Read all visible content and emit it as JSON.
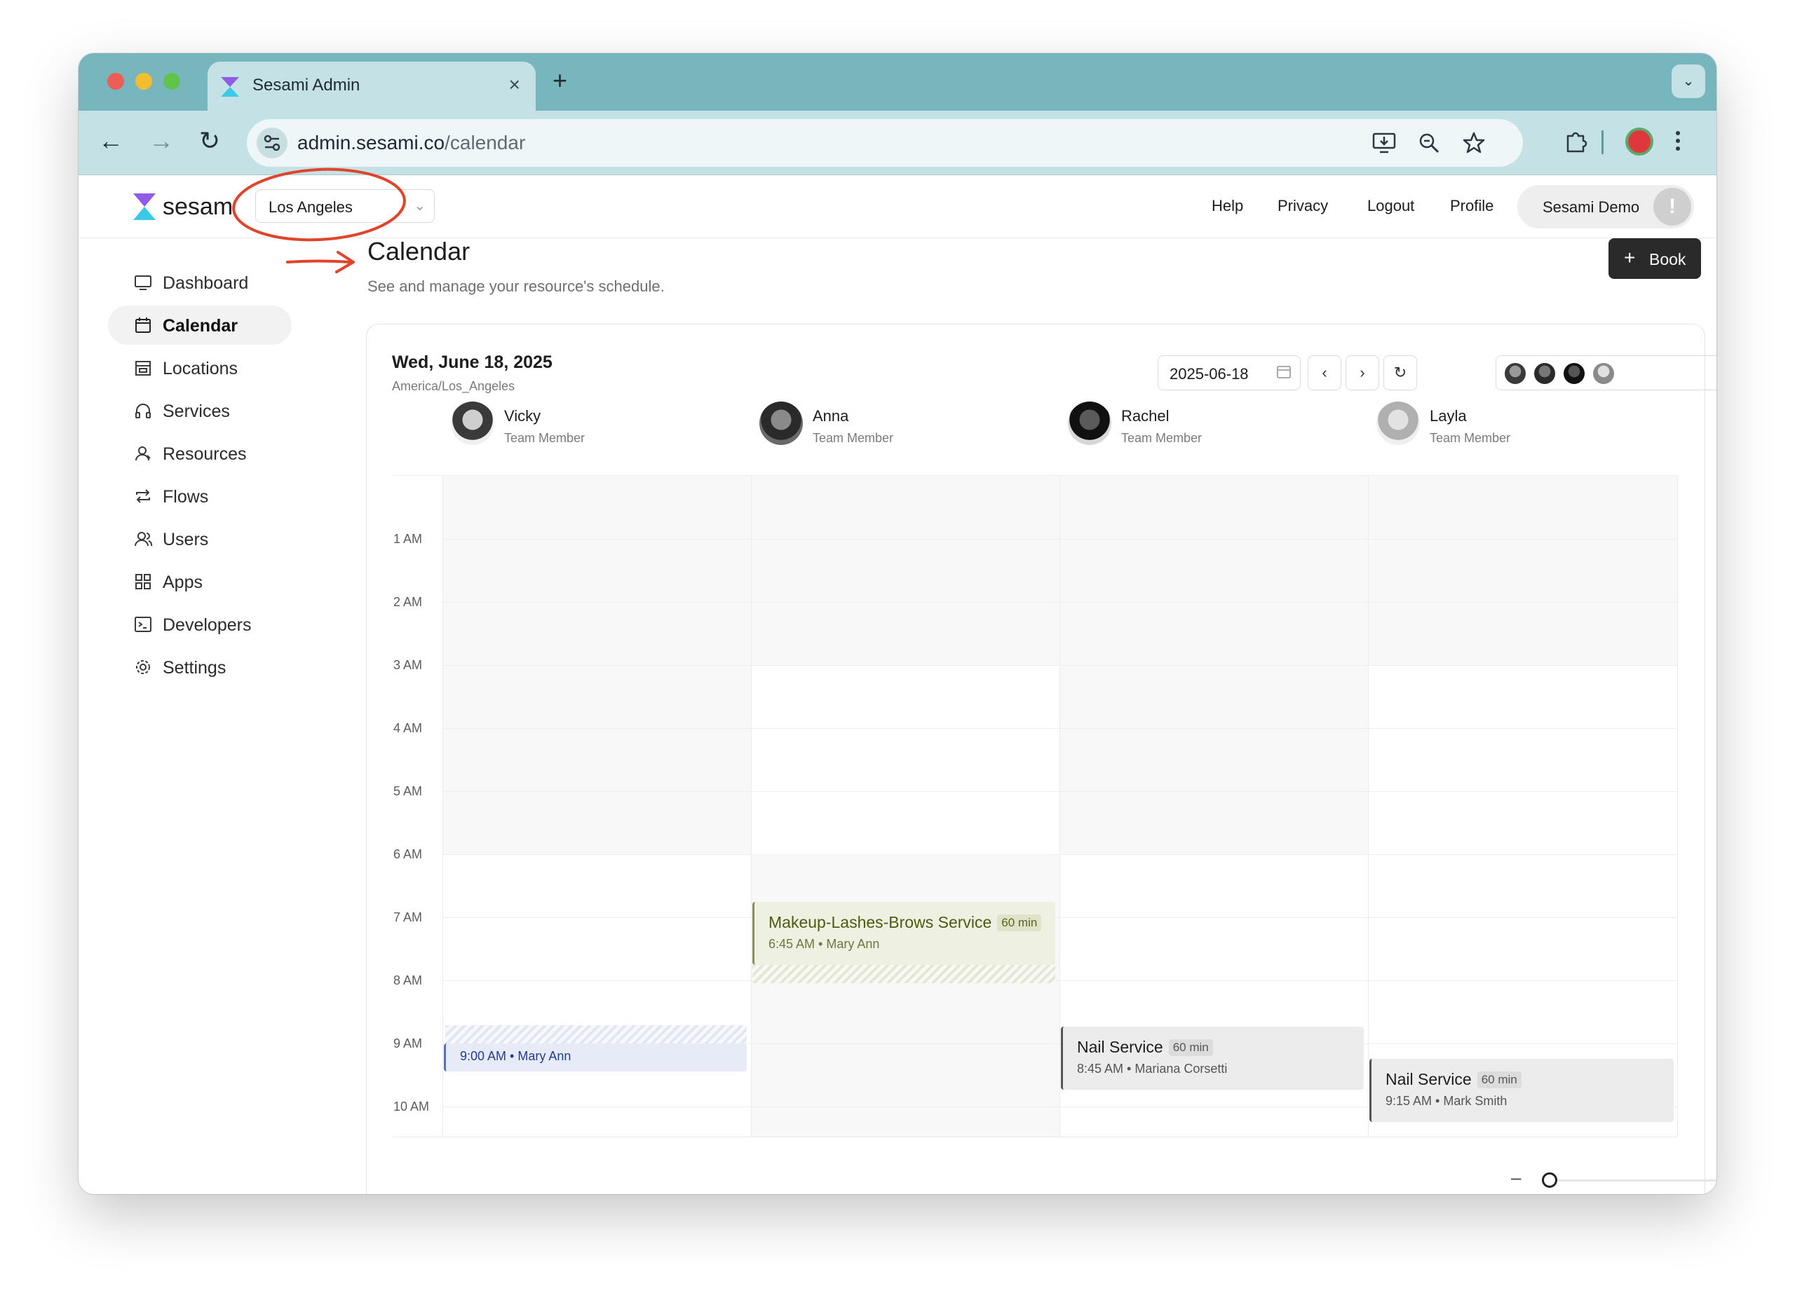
{
  "browser": {
    "tab_title": "Sesami Admin",
    "tab_close": "×",
    "new_tab": "+",
    "tabs_menu": "⌄",
    "back": "←",
    "forward": "→",
    "reload": "↻",
    "url_host": "admin.sesami.co",
    "url_path": "/calendar",
    "icons": [
      "install-icon",
      "zoom-icon",
      "bookmark-star-icon",
      "extensions-icon",
      "profile-icon",
      "menu-icon"
    ]
  },
  "header": {
    "brand": "sesam",
    "location": "Los Angeles",
    "links": [
      "Help",
      "Privacy",
      "Logout",
      "Profile"
    ],
    "user_name": "Sesami Demo",
    "user_avatar": "!"
  },
  "sidebar": {
    "items": [
      {
        "label": "Dashboard",
        "icon": "monitor-icon"
      },
      {
        "label": "Calendar",
        "icon": "calendar-icon",
        "active": true
      },
      {
        "label": "Locations",
        "icon": "store-icon"
      },
      {
        "label": "Services",
        "icon": "headphones-icon"
      },
      {
        "label": "Resources",
        "icon": "person-icon"
      },
      {
        "label": "Flows",
        "icon": "repeat-icon"
      },
      {
        "label": "Users",
        "icon": "users-icon"
      },
      {
        "label": "Apps",
        "icon": "apps-icon"
      },
      {
        "label": "Developers",
        "icon": "terminal-icon"
      },
      {
        "label": "Settings",
        "icon": "gear-icon"
      }
    ]
  },
  "page": {
    "title": "Calendar",
    "subtitle": "See and manage your resource's schedule.",
    "book_label": "Book"
  },
  "calendar": {
    "date_heading": "Wed, June 18, 2025",
    "timezone": "America/Los_Angeles",
    "date_value": "2025-06-18",
    "resources": [
      {
        "name": "Vicky",
        "role": "Team Member"
      },
      {
        "name": "Anna",
        "role": "Team Member"
      },
      {
        "name": "Rachel",
        "role": "Team Member"
      },
      {
        "name": "Layla",
        "role": "Team Member"
      }
    ],
    "hours": [
      "1 AM",
      "2 AM",
      "3 AM",
      "4 AM",
      "5 AM",
      "6 AM",
      "7 AM",
      "8 AM",
      "9 AM",
      "10 AM"
    ],
    "events": [
      {
        "title": "",
        "duration": "",
        "meta": "9:00 AM • Mary Ann"
      },
      {
        "title": "Makeup-Lashes-Brows Service",
        "duration": "60 min",
        "meta": "6:45 AM • Mary Ann"
      },
      {
        "title": "Nail Service",
        "duration": "60 min",
        "meta": "8:45 AM • Mariana Corsetti"
      },
      {
        "title": "Nail Service",
        "duration": "60 min",
        "meta": "9:15 AM • Mark Smith"
      }
    ],
    "zoom_minus": "–",
    "zoom_plus": "+"
  }
}
